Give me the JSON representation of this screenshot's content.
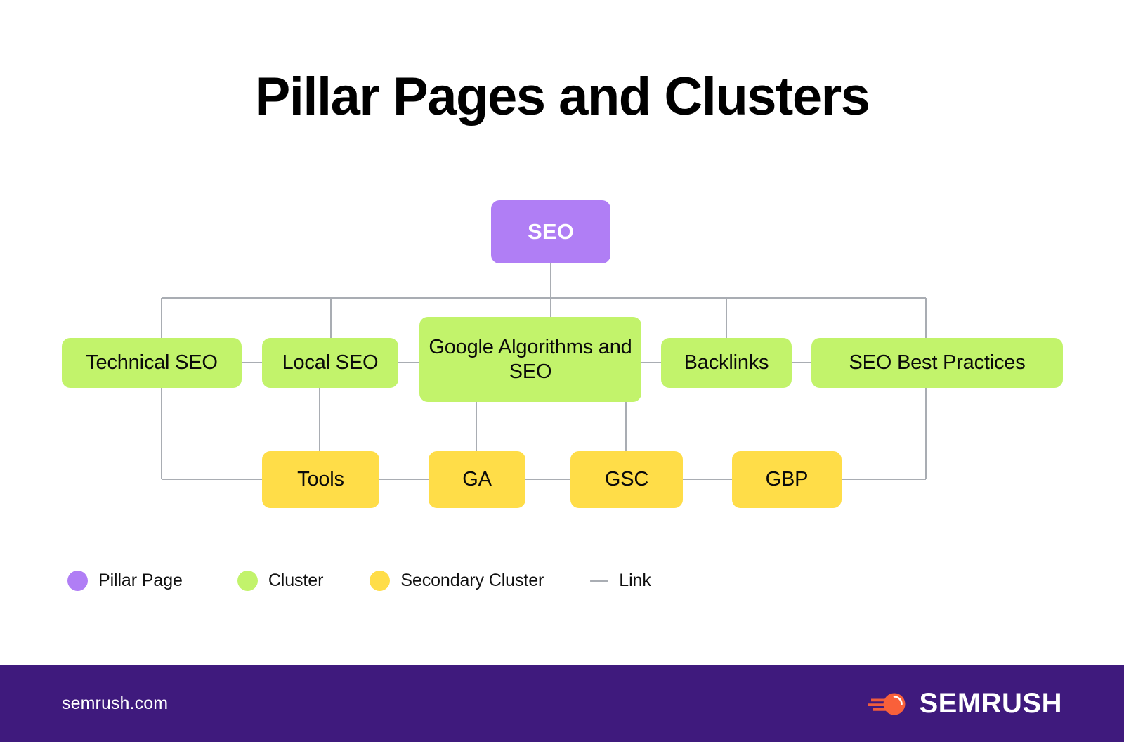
{
  "page": {
    "title": "Pillar Pages and Clusters",
    "background_color": "#ffffff"
  },
  "colors": {
    "pillar": "#b07ef5",
    "cluster": "#c2f36b",
    "secondary": "#ffdd48",
    "link": "#a9adb3",
    "footer_bg": "#3f1a7d",
    "brand_orange": "#f9603a",
    "text": "#0a0a0a"
  },
  "diagram": {
    "pillar": {
      "label": "SEO"
    },
    "clusters": [
      {
        "label": "Technical SEO"
      },
      {
        "label": "Local SEO"
      },
      {
        "label": "Google Algorithms and SEO"
      },
      {
        "label": "Backlinks"
      },
      {
        "label": "SEO Best Practices"
      }
    ],
    "secondary_clusters": [
      {
        "label": "Tools"
      },
      {
        "label": "GA"
      },
      {
        "label": "GSC"
      },
      {
        "label": "GBP"
      }
    ]
  },
  "legend": {
    "items": [
      {
        "label": "Pillar Page",
        "swatch": "pillar-circle",
        "color": "#b07ef5"
      },
      {
        "label": "Cluster",
        "swatch": "cluster-circle",
        "color": "#c2f36b"
      },
      {
        "label": "Secondary Cluster",
        "swatch": "secondary-circle",
        "color": "#ffdd48"
      },
      {
        "label": "Link",
        "swatch": "link-dash",
        "color": "#a9adb3"
      }
    ]
  },
  "footer": {
    "url": "semrush.com",
    "brand_name": "SEMRUSH",
    "brand_icon": "semrush-comet-icon"
  }
}
